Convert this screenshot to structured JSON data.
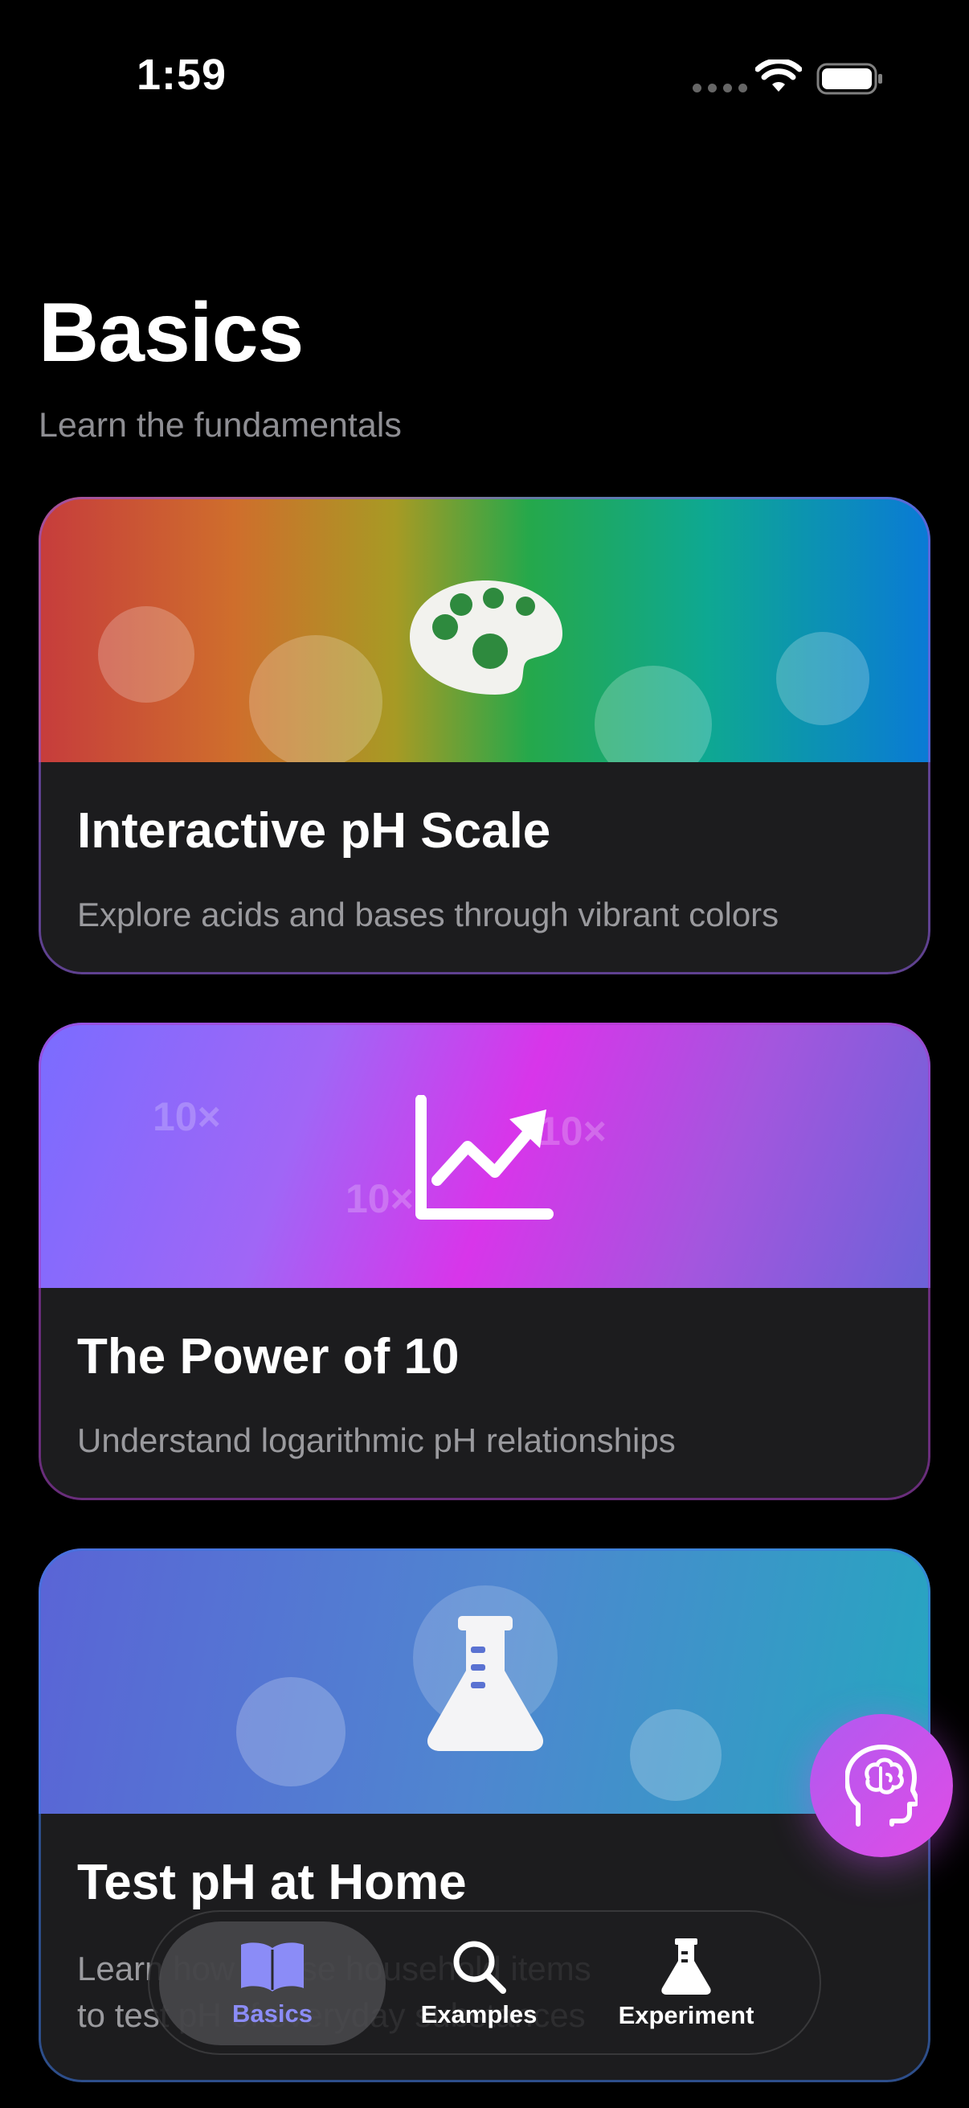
{
  "status_bar": {
    "time": "1:59"
  },
  "header": {
    "title": "Basics",
    "subtitle": "Learn the fundamentals"
  },
  "cards": [
    {
      "title": "Interactive pH Scale",
      "description": "Explore acids and bases through vibrant colors",
      "icon": "palette-icon"
    },
    {
      "title": "The Power of 10",
      "description": "Understand logarithmic pH relationships",
      "icon": "chart-line-up-icon",
      "decor": [
        "10×",
        "10×",
        "10×"
      ]
    },
    {
      "title": "Test pH at Home",
      "description": "Learn how to use household items to test pH of everyday substances",
      "icon": "flask-icon"
    }
  ],
  "tab_bar": {
    "tabs": [
      {
        "label": "Basics",
        "icon": "book-icon",
        "active": true
      },
      {
        "label": "Examples",
        "icon": "search-icon",
        "active": false
      },
      {
        "label": "Experiment",
        "icon": "flask-icon",
        "active": false
      }
    ],
    "active_color": "#8b8cf7"
  },
  "fab": {
    "icon": "brain-head-icon"
  }
}
